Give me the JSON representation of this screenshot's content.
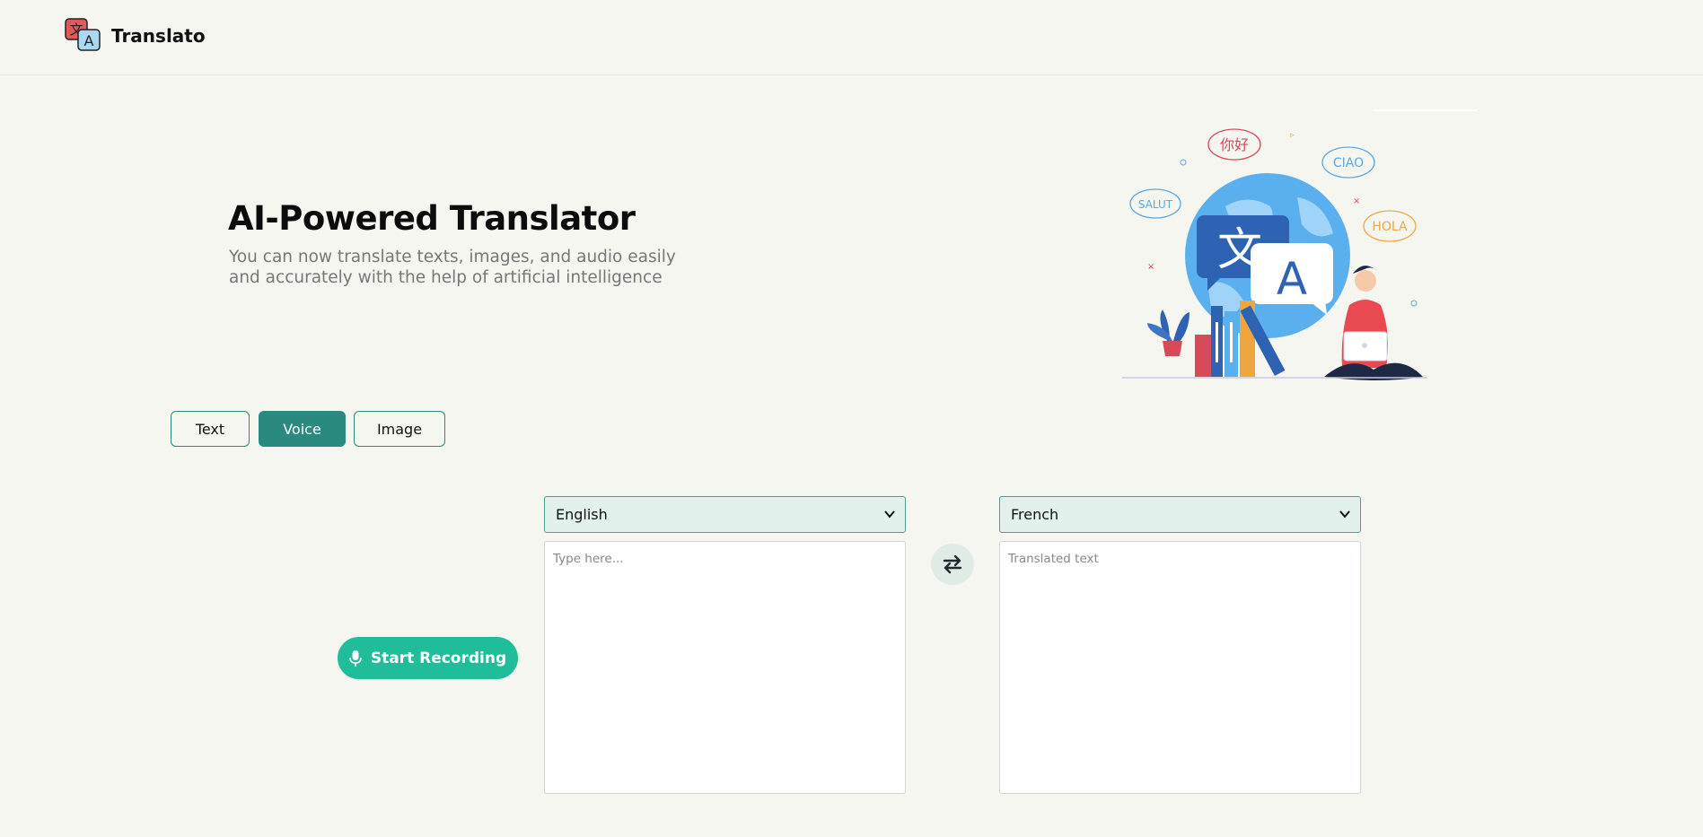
{
  "header": {
    "brand": "Translato",
    "logo_glyphs": {
      "back": "文",
      "front": "A"
    }
  },
  "hero": {
    "title": "AI-Powered Translator",
    "subtitle": "You can now translate texts, images, and audio easily and accurately with the help of artificial intelligence",
    "illustration_words": [
      "你好",
      "CIAO",
      "SALUT",
      "HOLA"
    ],
    "illustration_glyphs": [
      "文",
      "A"
    ]
  },
  "tabs": [
    {
      "label": "Text",
      "active": false
    },
    {
      "label": "Voice",
      "active": true
    },
    {
      "label": "Image",
      "active": false
    }
  ],
  "translator": {
    "source_language": "English",
    "target_language": "French",
    "source_placeholder": "Type here...",
    "target_placeholder": "Translated text",
    "swap_icon": "swap-arrows-icon"
  },
  "recording": {
    "button_label": "Start Recording",
    "icon": "microphone-icon"
  },
  "colors": {
    "background": "#f6f6f1",
    "accent": "#2a8a7f",
    "record_green": "#1fbd9a",
    "select_bg": "#e3f1ed"
  }
}
